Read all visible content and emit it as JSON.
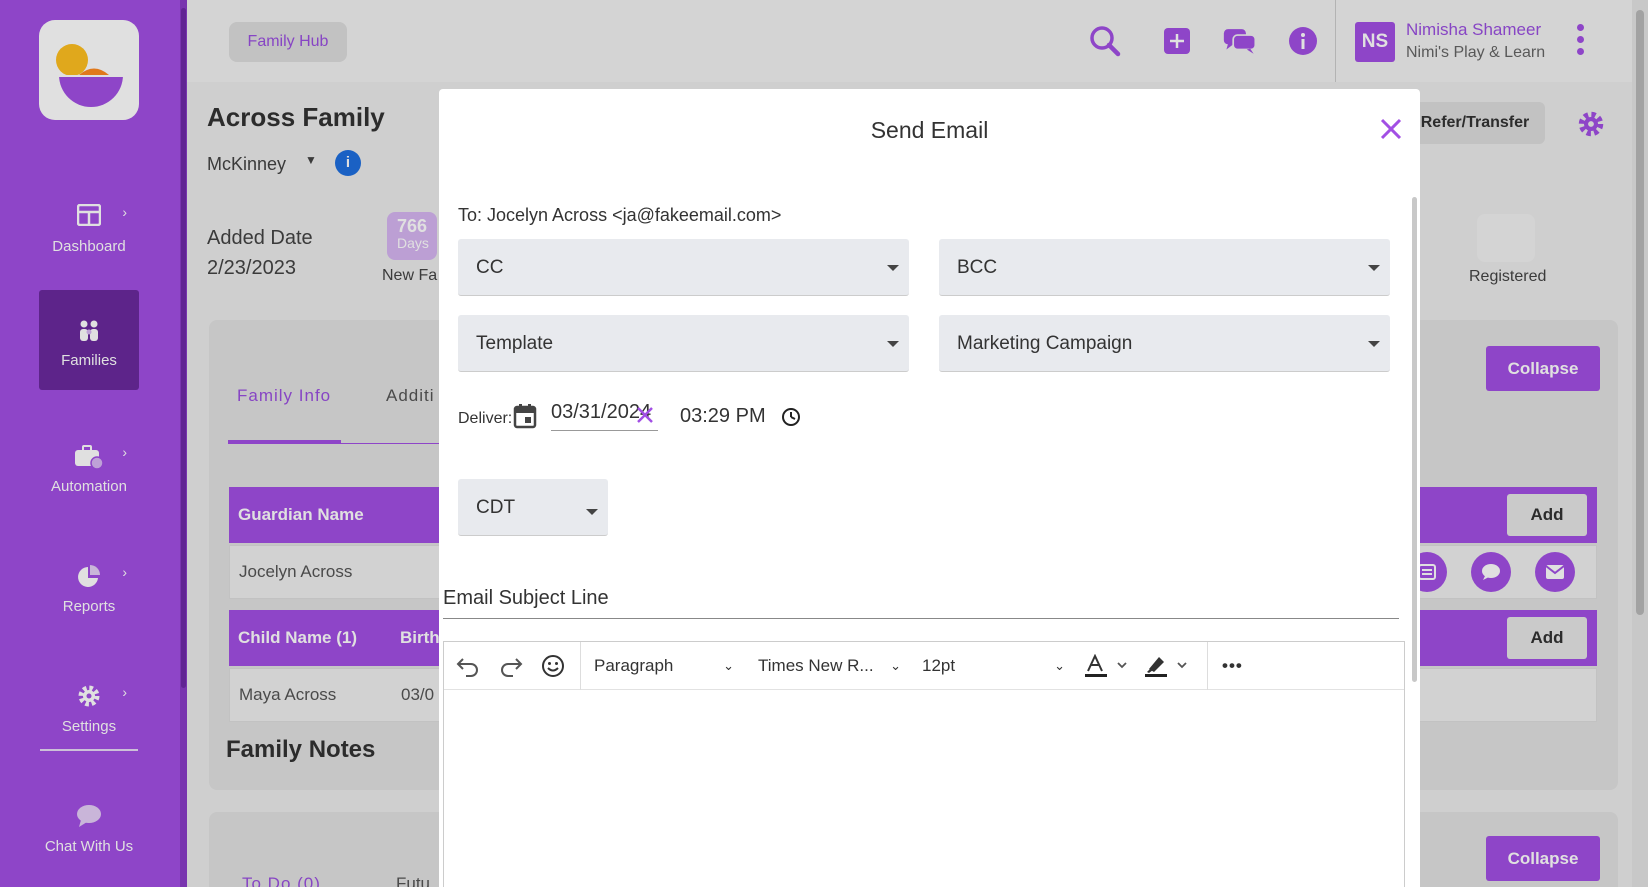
{
  "sidebar": {
    "items": [
      {
        "label": "Dashboard",
        "icon": "dashboard-icon"
      },
      {
        "label": "Families",
        "icon": "families-icon"
      },
      {
        "label": "Automation",
        "icon": "automation-icon"
      },
      {
        "label": "Reports",
        "icon": "reports-icon"
      },
      {
        "label": "Settings",
        "icon": "settings-icon"
      },
      {
        "label": "Chat With Us",
        "icon": "chat-icon"
      }
    ]
  },
  "topbar": {
    "breadcrumb": "Family Hub",
    "user_initials": "NS",
    "user_name": "Nimisha Shameer",
    "user_org": "Nimi's Play & Learn"
  },
  "family": {
    "title": "Across Family",
    "location": "McKinney",
    "added_label": "Added Date",
    "added_value": "2/23/2023",
    "days_count": "766",
    "days_unit": "Days",
    "new_family_label": "New Fa",
    "registered_label": "Registered",
    "refer_button": "Refer/Transfer",
    "collapse_button": "Collapse",
    "tabs": [
      "Family Info",
      "Additi"
    ],
    "guardian_header": "Guardian Name",
    "guardian_row": "Jocelyn Across",
    "child_header": "Child Name (1)",
    "birth_header": "Birth",
    "child_row": "Maya Across",
    "child_birth": "03/0",
    "add_button": "Add",
    "notes_title": "Family Notes",
    "todo_tab": "To Do (0)",
    "future_tab": "Futu"
  },
  "modal": {
    "title": "Send Email",
    "to_line": "To: Jocelyn Across <ja@fakeemail.com>",
    "cc_label": "CC",
    "bcc_label": "BCC",
    "template_label": "Template",
    "campaign_label": "Marketing Campaign",
    "deliver_label": "Deliver:",
    "date_value": "03/31/2024",
    "time_value": "03:29 PM",
    "timezone": "CDT",
    "subject_placeholder": "Email Subject Line",
    "editor": {
      "block_format": "Paragraph",
      "font_family": "Times New R...",
      "font_size": "12pt",
      "more": "•••"
    }
  },
  "colors": {
    "brand_purple": "#a24fe4",
    "brand_dark": "#6a2a9e",
    "info_blue": "#1e6fe0"
  }
}
